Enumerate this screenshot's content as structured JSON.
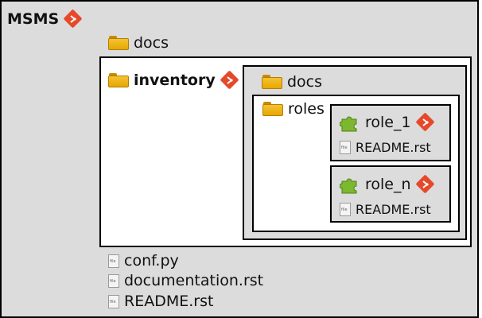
{
  "root": {
    "name": "MSMS"
  },
  "top_docs": "docs",
  "inventory": {
    "name": "inventory",
    "docs": "docs",
    "roles": "roles",
    "role_1": {
      "name": "role_1",
      "readme": "README.rst"
    },
    "role_n": {
      "name": "role_n",
      "readme": "README.rst"
    }
  },
  "files": [
    "conf.py",
    "documentation.rst",
    "README.rst"
  ],
  "colors": {
    "background": "#dcdcdc",
    "git": "#e5492a",
    "folder": "#f0b400",
    "puzzle": "#7cb82f"
  },
  "icons": {
    "folder": "folder-icon",
    "file": "file-icon",
    "git": "git-icon",
    "role": "puzzle-icon"
  }
}
